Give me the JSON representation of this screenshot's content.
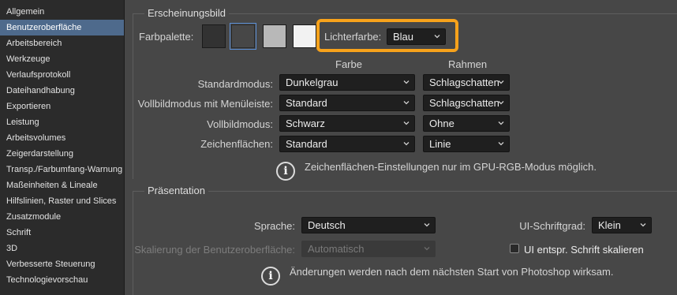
{
  "sidebar": {
    "items": [
      {
        "label": "Allgemein"
      },
      {
        "label": "Benutzeroberfläche",
        "active": true
      },
      {
        "label": "Arbeitsbereich"
      },
      {
        "label": "Werkzeuge"
      },
      {
        "label": "Verlaufsprotokoll"
      },
      {
        "label": "Dateihandhabung"
      },
      {
        "label": "Exportieren"
      },
      {
        "label": "Leistung"
      },
      {
        "label": "Arbeitsvolumes"
      },
      {
        "label": "Zeigerdarstellung"
      },
      {
        "label": "Transp./Farbumfang-Warnung"
      },
      {
        "label": "Maßeinheiten & Lineale"
      },
      {
        "label": "Hilfslinien, Raster und Slices"
      },
      {
        "label": "Zusatzmodule"
      },
      {
        "label": "Schrift"
      },
      {
        "label": "3D"
      },
      {
        "label": "Verbesserte Steuerung"
      },
      {
        "label": "Technologievorschau"
      }
    ]
  },
  "appearance": {
    "title": "Erscheinungsbild",
    "palette_label": "Farbpalette:",
    "swatch_colors": [
      "#323232",
      "#474747",
      "#b8b8b8",
      "#f2f2f2"
    ],
    "highlight_label": "Lichterfarbe:",
    "highlight_value": "Blau",
    "col_color": "Farbe",
    "col_border": "Rahmen",
    "rows": [
      {
        "label": "Standardmodus:",
        "color": "Dunkelgrau",
        "border": "Schlagschatten"
      },
      {
        "label": "Vollbildmodus mit Menüleiste:",
        "color": "Standard",
        "border": "Schlagschatten"
      },
      {
        "label": "Vollbildmodus:",
        "color": "Schwarz",
        "border": "Ohne"
      },
      {
        "label": "Zeichenflächen:",
        "color": "Standard",
        "border": "Linie"
      }
    ],
    "info": "Zeichenflächen-Einstellungen nur im GPU-RGB-Modus möglich."
  },
  "presentation": {
    "title": "Präsentation",
    "language_label": "Sprache:",
    "language_value": "Deutsch",
    "font_size_label": "UI-Schriftgrad:",
    "font_size_value": "Klein",
    "scaling_label": "Skalierung der Benutzeroberfläche:",
    "scaling_value": "Automatisch",
    "scale_checkbox_label": "UI entspr. Schrift skalieren",
    "info": "Änderungen werden nach dem nächsten Start von Photoshop wirksam."
  },
  "colors": {
    "accent_highlight": "#f7a21b",
    "selected_sidebar": "#4e6a8c"
  }
}
